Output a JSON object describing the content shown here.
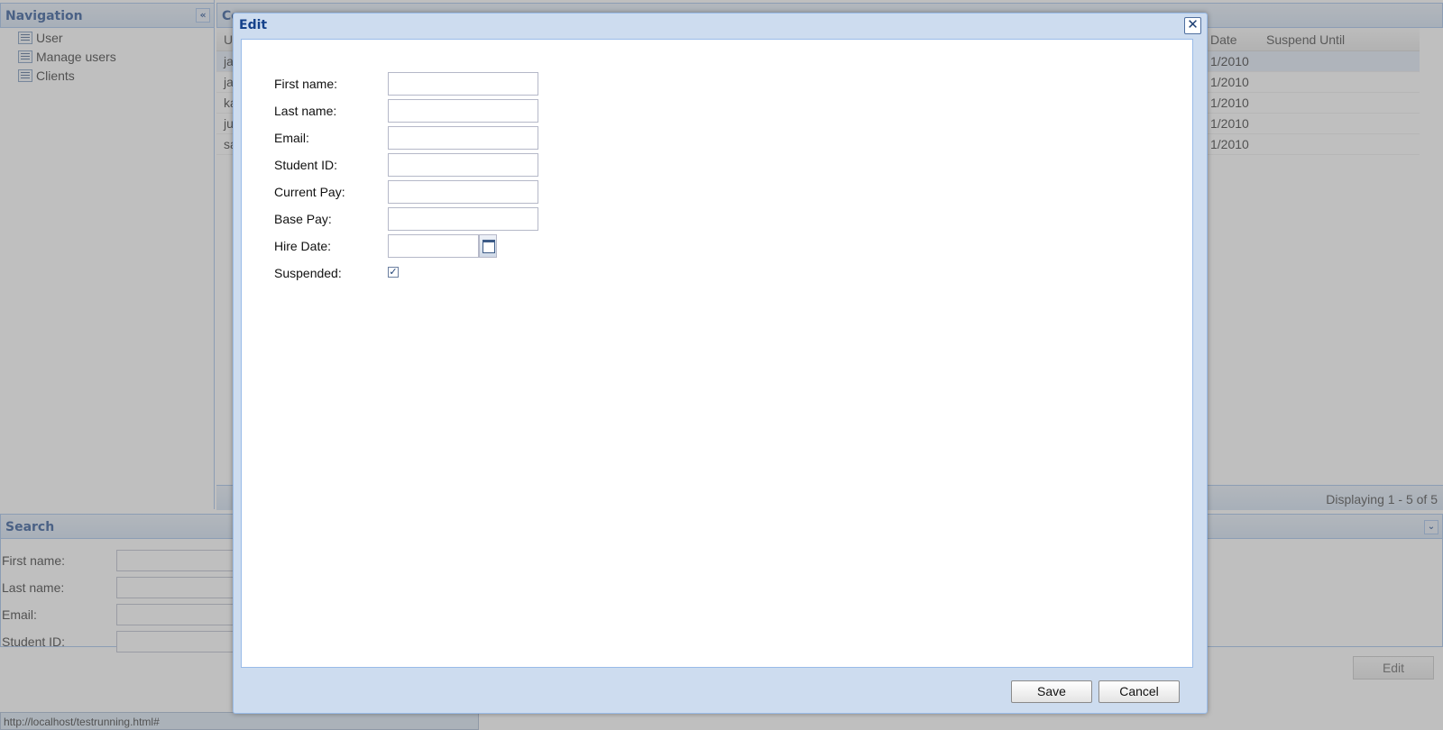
{
  "navigation": {
    "title": "Navigation",
    "items": [
      {
        "label": "User"
      },
      {
        "label": "Manage users"
      },
      {
        "label": "Clients"
      }
    ]
  },
  "grid": {
    "title": "Co",
    "columns": {
      "first": "U",
      "date": "Date",
      "suspend": "Suspend Until"
    },
    "rows": [
      {
        "first": "ja",
        "date": "1/2010"
      },
      {
        "first": "ja",
        "date": "1/2010"
      },
      {
        "first": "ka",
        "date": "1/2010"
      },
      {
        "first": "jul",
        "date": "1/2010"
      },
      {
        "first": "sa",
        "date": "1/2010"
      }
    ],
    "paging": "Displaying 1 - 5 of 5"
  },
  "search": {
    "title": "Search",
    "fields": [
      "First name:",
      "Last name:",
      "Email:",
      "Student ID:"
    ]
  },
  "edit_button": "Edit",
  "status_bar": "http://localhost/testrunning.html#",
  "dialog": {
    "title": "Edit",
    "close_symbol": "✕",
    "fields": {
      "first_name": "First name:",
      "last_name": "Last name:",
      "email": "Email:",
      "student_id": "Student ID:",
      "current_pay": "Current Pay:",
      "base_pay": "Base Pay:",
      "hire_date": "Hire Date:",
      "suspended": "Suspended:"
    },
    "suspended_checked": true,
    "check_mark": "✓",
    "save_label": "Save",
    "cancel_label": "Cancel"
  }
}
